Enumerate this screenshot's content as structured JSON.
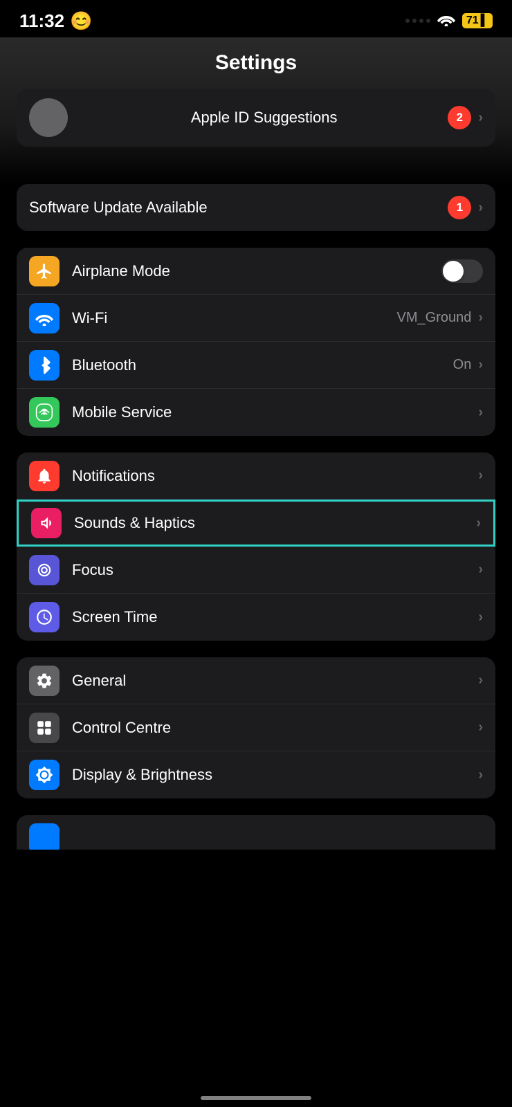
{
  "statusBar": {
    "time": "11:32",
    "faceIcon": "😊",
    "batteryLevel": "71",
    "batteryColor": "#f5c518"
  },
  "header": {
    "title": "Settings"
  },
  "appleIdSection": {
    "badgeCount": "2",
    "label": "Apple ID Suggestions"
  },
  "softwareUpdate": {
    "label": "Software Update Available",
    "badgeCount": "1"
  },
  "networkSection": {
    "items": [
      {
        "id": "airplane-mode",
        "label": "Airplane Mode",
        "icon": "✈",
        "iconClass": "icon-orange",
        "toggle": true,
        "toggleOn": false,
        "value": "",
        "chevron": false
      },
      {
        "id": "wifi",
        "label": "Wi-Fi",
        "icon": "wifi",
        "iconClass": "icon-blue",
        "toggle": false,
        "value": "VM_Ground",
        "chevron": true
      },
      {
        "id": "bluetooth",
        "label": "Bluetooth",
        "icon": "bluetooth",
        "iconClass": "icon-blue",
        "toggle": false,
        "value": "On",
        "chevron": true
      },
      {
        "id": "mobile-service",
        "label": "Mobile Service",
        "icon": "mobile",
        "iconClass": "icon-green",
        "toggle": false,
        "value": "",
        "chevron": true
      }
    ]
  },
  "personalSection": {
    "items": [
      {
        "id": "notifications",
        "label": "Notifications",
        "icon": "notifications",
        "iconClass": "icon-red",
        "chevron": true,
        "highlighted": false
      },
      {
        "id": "sounds-haptics",
        "label": "Sounds & Haptics",
        "icon": "sounds",
        "iconClass": "icon-red-pink",
        "chevron": true,
        "highlighted": true
      },
      {
        "id": "focus",
        "label": "Focus",
        "icon": "focus",
        "iconClass": "icon-purple",
        "chevron": true,
        "highlighted": false
      },
      {
        "id": "screen-time",
        "label": "Screen Time",
        "icon": "screen-time",
        "iconClass": "icon-purple-dark",
        "chevron": true,
        "highlighted": false
      }
    ]
  },
  "generalSection": {
    "items": [
      {
        "id": "general",
        "label": "General",
        "icon": "gear",
        "iconClass": "icon-gray",
        "chevron": true
      },
      {
        "id": "control-centre",
        "label": "Control Centre",
        "icon": "control",
        "iconClass": "icon-gray-dark",
        "chevron": true
      },
      {
        "id": "display-brightness",
        "label": "Display & Brightness",
        "icon": "display",
        "iconClass": "icon-blue-bright",
        "chevron": true
      }
    ]
  },
  "chevronChar": "›",
  "bottomItem": {
    "iconClass": "icon-blue"
  }
}
